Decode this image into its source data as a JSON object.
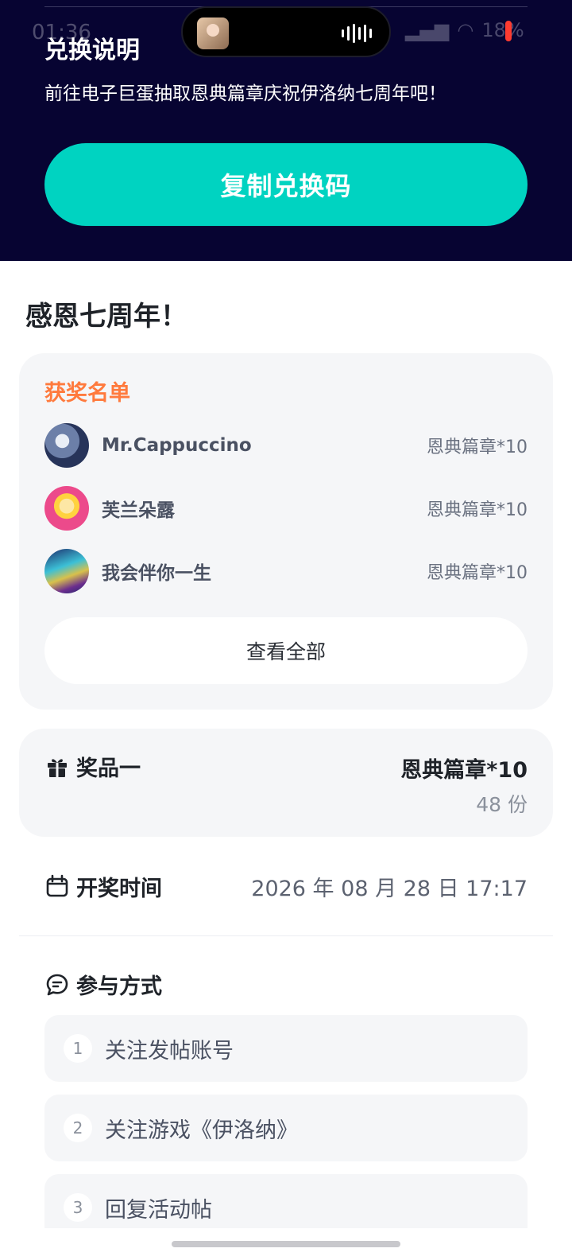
{
  "status_bar": {
    "time": "01:36",
    "battery_percent": "18%"
  },
  "redeem": {
    "title": "兑换说明",
    "description": "前往电子巨蛋抽取恩典篇章庆祝伊洛纳七周年吧！",
    "copy_button": "复制兑换码"
  },
  "event": {
    "title": "感恩七周年！"
  },
  "winners": {
    "title": "获奖名单",
    "list": [
      {
        "name": "Mr.Cappuccino",
        "prize": "恩典篇章*10"
      },
      {
        "name": "芙兰朵露",
        "prize": "恩典篇章*10"
      },
      {
        "name": "我会伴你一生",
        "prize": "恩典篇章*10"
      }
    ],
    "view_all": "查看全部"
  },
  "prize": {
    "label": "奖品一",
    "value": "恩典篇章*10",
    "count": "48 份",
    "icon": "gift-icon"
  },
  "draw": {
    "label": "开奖时间",
    "time": "2026 年 08 月 28 日 17:17",
    "icon": "calendar-icon"
  },
  "participation": {
    "label": "参与方式",
    "icon": "chat-icon",
    "steps": [
      {
        "num": "1",
        "text": "关注发帖账号"
      },
      {
        "num": "2",
        "text": "关注游戏《伊洛纳》"
      },
      {
        "num": "3",
        "text": "回复活动帖"
      }
    ]
  },
  "colors": {
    "header_bg": "#070432",
    "primary_button": "#00d3c1",
    "winners_title": "#ff7a3d",
    "card_bg": "#f5f6f8"
  }
}
